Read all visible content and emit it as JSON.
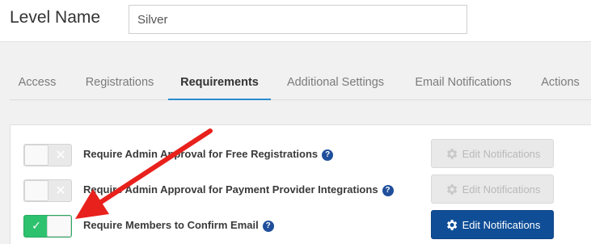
{
  "header": {
    "level_label": "Level Name",
    "level_value": "Silver"
  },
  "tabs": [
    {
      "label": "Access"
    },
    {
      "label": "Registrations"
    },
    {
      "label": "Requirements"
    },
    {
      "label": "Additional Settings"
    },
    {
      "label": "Email Notifications"
    },
    {
      "label": "Actions"
    }
  ],
  "active_tab": "Requirements",
  "requirements": [
    {
      "label": "Require Admin Approval for Free Registrations",
      "enabled": false,
      "button_label": "Edit Notifications"
    },
    {
      "label": "Require Admin Approval for Payment Provider Integrations",
      "enabled": false,
      "button_label": "Edit Notifications"
    },
    {
      "label": "Require Members to Confirm Email",
      "enabled": true,
      "button_label": "Edit Notifications"
    }
  ],
  "icons": {
    "help": "question-circle-icon",
    "gear": "gear-icon",
    "toggle_off": "x-icon",
    "toggle_on": "check-icon"
  },
  "colors": {
    "accent_blue": "#0f4e97",
    "tab_underline": "#2a8bd0",
    "toggle_on": "#2ec26f",
    "annotation_arrow": "#e8211c"
  }
}
